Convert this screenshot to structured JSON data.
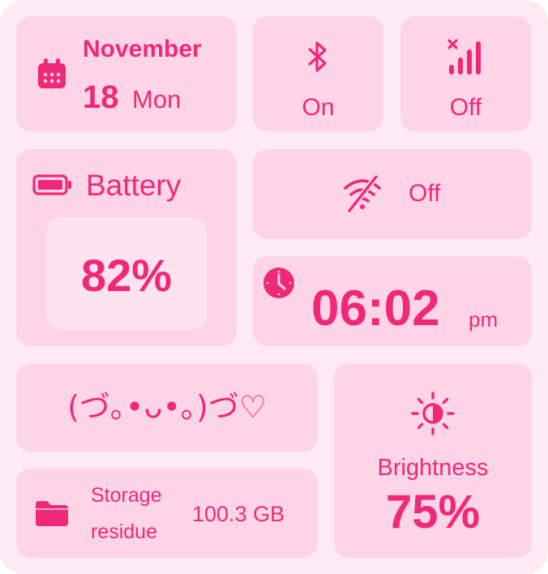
{
  "date": {
    "month": "November",
    "day": "18",
    "weekday": "Mon"
  },
  "bluetooth": {
    "status": "On"
  },
  "signal": {
    "status": "Off"
  },
  "battery": {
    "label": "Battery",
    "percent": "82%"
  },
  "wifi": {
    "status": "Off"
  },
  "clock": {
    "time": "06:02",
    "ampm": "pm"
  },
  "kaomoji": {
    "text": "(づ｡•ᴗ•｡)づ♡"
  },
  "storage": {
    "label_line1": "Storage",
    "label_line2": "residue",
    "value": "100.3 GB"
  },
  "brightness": {
    "label": "Brightness",
    "percent": "75%"
  },
  "colors": {
    "accent": "#f0287a",
    "tile": "#fdd5e6",
    "background": "#fdeaf2",
    "inner": "#fde3ee"
  },
  "icons": [
    "calendar-icon",
    "bluetooth-icon",
    "cellular-off-icon",
    "battery-icon",
    "wifi-off-icon",
    "clock-icon",
    "folder-icon",
    "brightness-icon"
  ]
}
